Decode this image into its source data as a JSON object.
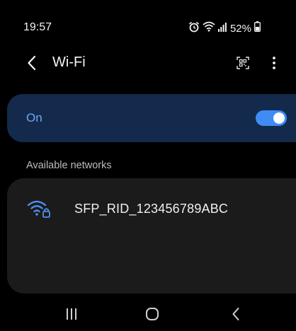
{
  "status_bar": {
    "time": "19:57",
    "battery_text": "52%",
    "icons": [
      "alarm-icon",
      "wifi-icon",
      "signal-icon",
      "battery-icon"
    ]
  },
  "app_bar": {
    "title": "Wi-Fi",
    "icons": [
      "back-arrow-icon",
      "qr-code-icon",
      "more-vertical-icon"
    ]
  },
  "wifi_toggle": {
    "label": "On",
    "state": "on"
  },
  "available_networks": {
    "header": "Available networks",
    "networks": [
      {
        "name": "SFP_RID_123456789ABC",
        "icon": "wifi-locked-icon"
      }
    ]
  },
  "nav_bar": {
    "icons": [
      "recent-apps-icon",
      "home-icon",
      "back-icon"
    ]
  },
  "colors": {
    "background": "#000000",
    "toggle_card": "#142a4c",
    "accent": "#3f8cf5",
    "toggle_label": "#6fa7f3",
    "networks_card": "#1b1b1b",
    "wifi_icon": "#4a90f2"
  }
}
